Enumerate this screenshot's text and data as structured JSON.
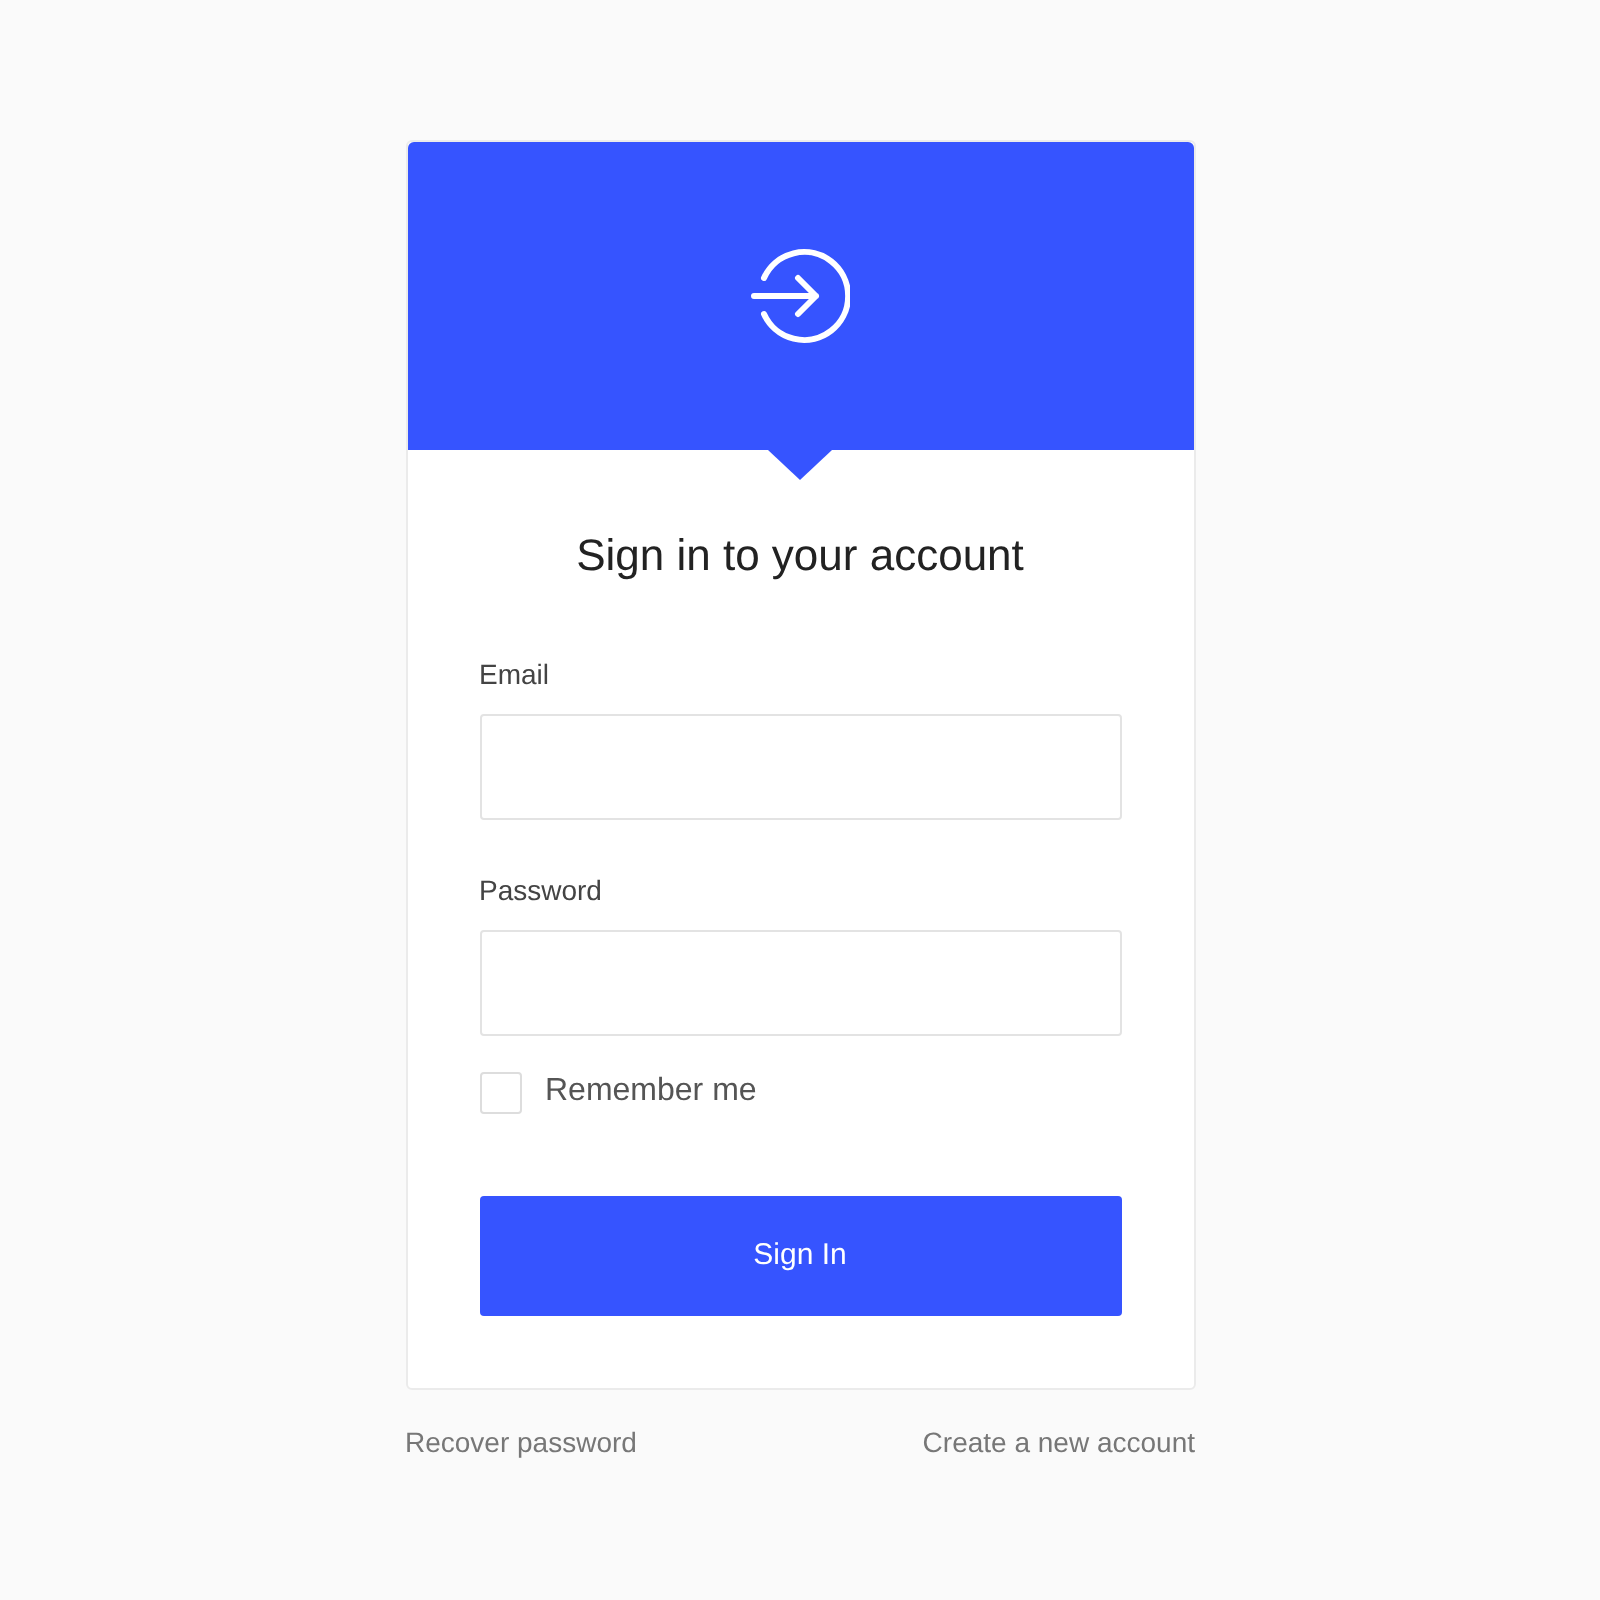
{
  "title": "Sign in to your account",
  "fields": [
    {
      "label": "Email"
    },
    {
      "label": "Password"
    }
  ],
  "remember": {
    "label": "Remember me",
    "checked": false
  },
  "submit": {
    "label": "Sign In"
  },
  "links": [
    {
      "label": "Recover password"
    },
    {
      "label": "Create a new account"
    }
  ]
}
